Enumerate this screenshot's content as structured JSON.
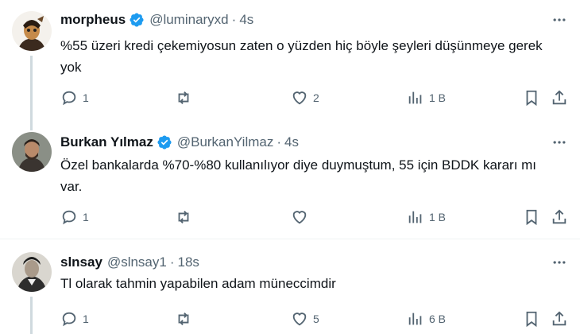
{
  "tweets": [
    {
      "name": "morpheus",
      "handle": "@luminaryxd",
      "dot": "·",
      "time": "4s",
      "text": "%55 üzeri kredi çekemiyosun zaten o yüzden hiç böyle şeyleri düşünmeye gerek yok",
      "replies": "1",
      "retweets": "",
      "likes": "2",
      "views": "1 B",
      "verified": true
    },
    {
      "name": "Burkan Yılmaz",
      "handle": "@BurkanYilmaz",
      "dot": "·",
      "time": "4s",
      "text": "Özel bankalarda %70-%80 kullanılıyor diye duymuştum, 55 için BDDK kararı mı var.",
      "replies": "1",
      "retweets": "",
      "likes": "",
      "views": "1 B",
      "verified": true
    },
    {
      "name": "slnsay",
      "handle": "@slnsay1",
      "dot": "·",
      "time": "18s",
      "text": "Tl olarak tahmin yapabilen adam müneccimdir",
      "replies": "1",
      "retweets": "",
      "likes": "5",
      "views": "6 B",
      "verified": false
    }
  ],
  "colors": {
    "verified": "#1d9bf0",
    "secondary": "#536471",
    "thread": "#cfd9de"
  }
}
